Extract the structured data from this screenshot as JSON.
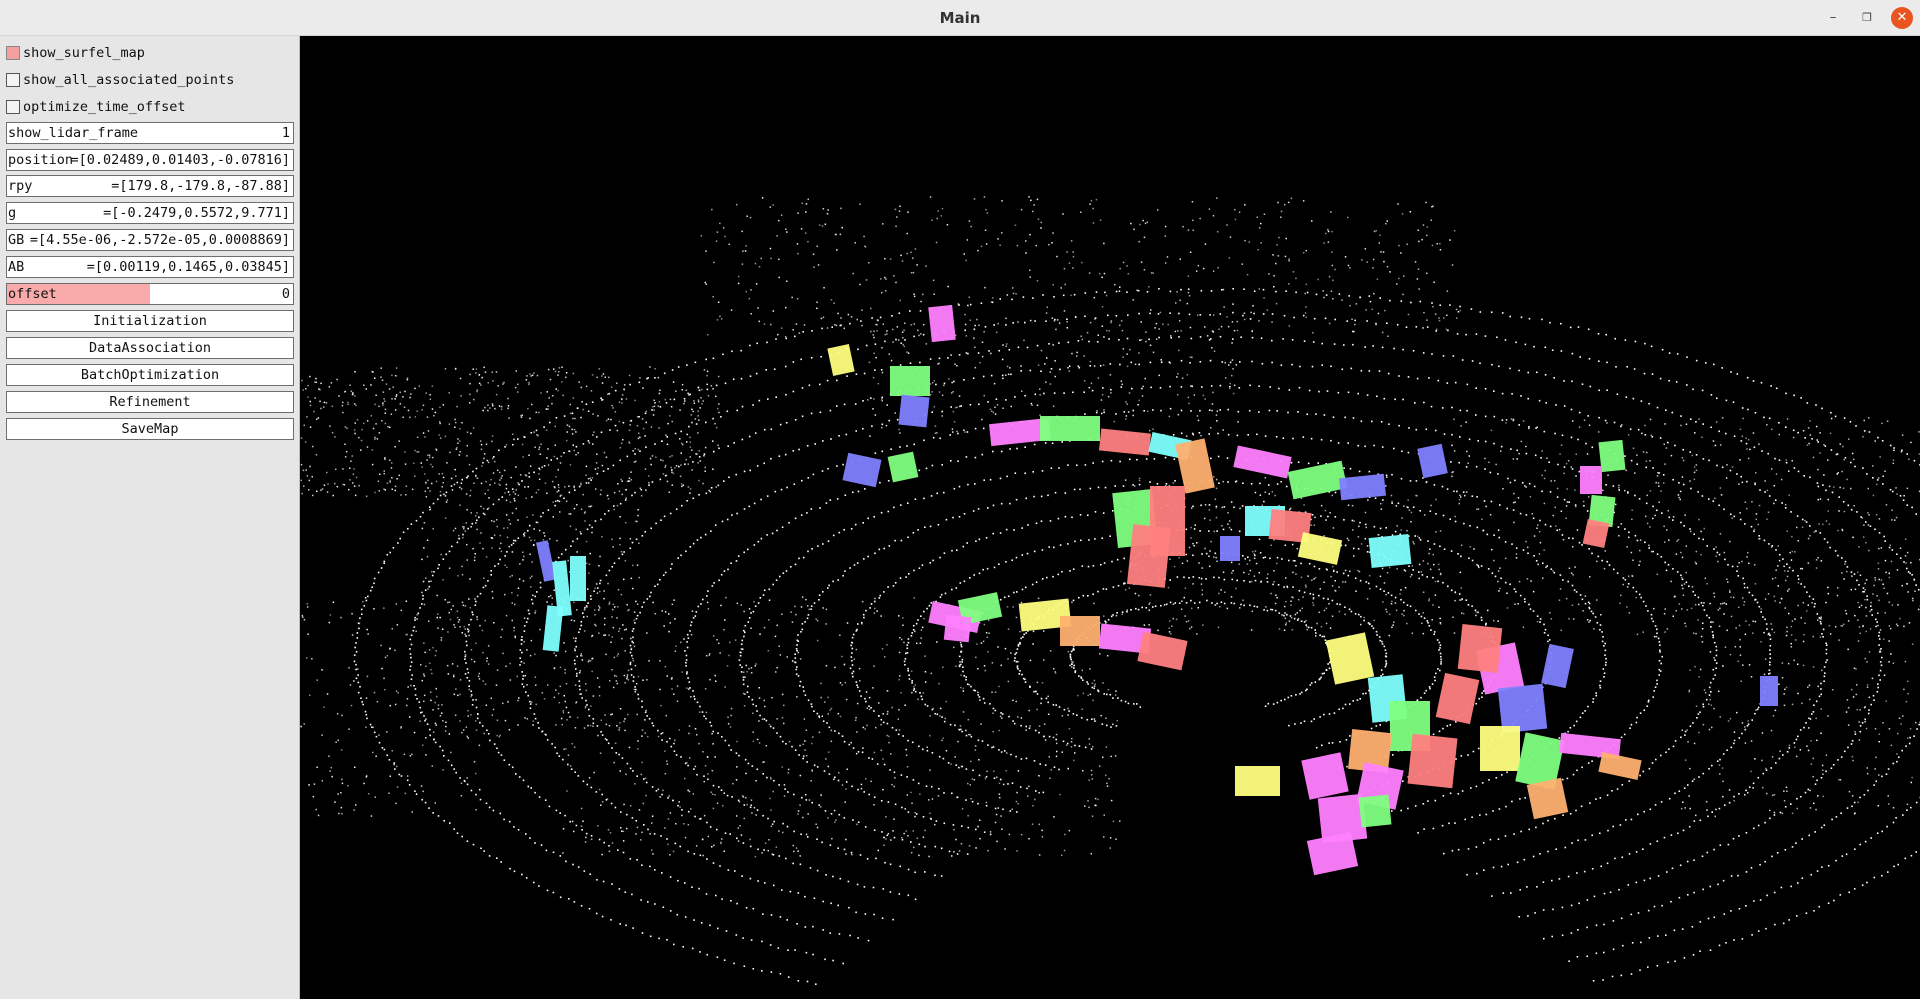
{
  "window": {
    "title": "Main",
    "controls": {
      "minimize": "–",
      "maximize": "❐",
      "close": "✕"
    },
    "close_color": "#e95420"
  },
  "panel": {
    "checkboxes": [
      {
        "label": "show_surfel_map",
        "checked": true
      },
      {
        "label": "show_all_associated_points",
        "checked": false
      },
      {
        "label": "optimize_time_offset",
        "checked": false
      }
    ],
    "fields": {
      "show_lidar_frame": {
        "label": "show_lidar_frame",
        "value": "1"
      },
      "position": {
        "label": "position",
        "value": "=[0.02489,0.01403,-0.07816]"
      },
      "rpy": {
        "label": "rpy",
        "value": "=[179.8,-179.8,-87.88]"
      },
      "g": {
        "label": "g",
        "value": "=[-0.2479,0.5572,9.771]"
      },
      "GB": {
        "label": "GB",
        "value": "=[4.55e-06,-2.572e-05,0.0008869]"
      },
      "AB": {
        "label": "AB",
        "value": "=[0.00119,0.1465,0.03845]"
      }
    },
    "offset_slider": {
      "label": "offset",
      "value": "0",
      "fill_fraction": 0.5,
      "fill_color": "#f9aaaa"
    },
    "buttons": {
      "initialization": "Initialization",
      "data_association": "DataAssociation",
      "batch_optimization": "BatchOptimization",
      "refinement": "Refinement",
      "save_map": "SaveMap"
    }
  },
  "viewport": {
    "background": "#000000",
    "point_color": "#ffffff",
    "surfel_colors": [
      "#ff8080",
      "#80ff80",
      "#8080ff",
      "#ffff80",
      "#ff80ff",
      "#80ffff",
      "#ffb070",
      "#b080ff",
      "#70ffc0"
    ]
  }
}
